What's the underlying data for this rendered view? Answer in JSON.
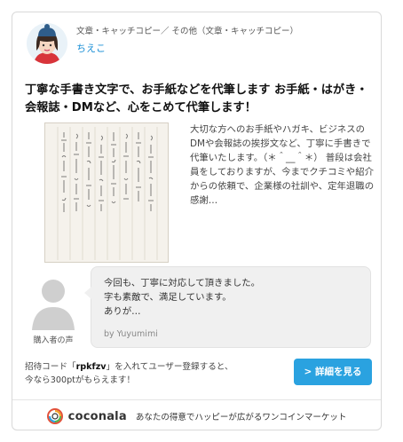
{
  "header": {
    "category": "文章・キャッチコピー／ その他（文章・キャッチコピー）",
    "seller_name": "ちえこ"
  },
  "service": {
    "title": "丁寧な手書き文字で、お手紙などを代筆します お手紙・はがき・会報誌・DMなど、心をこめて代筆します！",
    "description": "大切な方へのお手紙やハガキ、ビジネスのDMや会報誌の挨拶文など、丁寧に手書きで代筆いたします。（＊＾__＾＊） 普段は会社員をしておりますが、今までクチコミや紹介からの依頼で、企業様の社訓や、定年退職の感謝…"
  },
  "review": {
    "label": "購入者の声",
    "text": "今回も、丁寧に対応して頂きました。\n字も素敵で、満足しています。\nありが…",
    "by": "by Yuyumimi"
  },
  "invite": {
    "prefix": "招待コード「",
    "code": "rpkfzv",
    "suffix": "」を入れてユーザー登録すると、",
    "line2": "今なら300ptがもらえます！"
  },
  "button": {
    "label": "> 詳細を見る"
  },
  "footer": {
    "brand": "coconala",
    "tagline": "あなたの得意でハッピーが広がるワンコインマーケット"
  },
  "colors": {
    "accent": "#2aa2e0",
    "link": "#1a8fd6"
  }
}
